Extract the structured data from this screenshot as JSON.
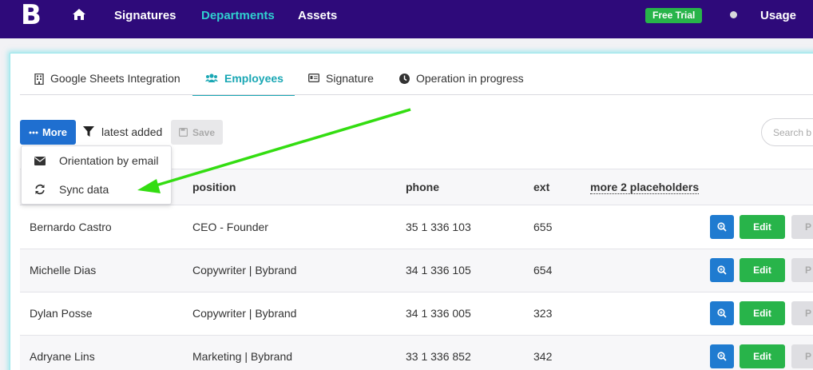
{
  "nav": {
    "logo": "B",
    "links": [
      "Signatures",
      "Departments",
      "Assets"
    ],
    "trial_badge": "Free Trial",
    "usage": "Usage"
  },
  "tabs": [
    "Google Sheets Integration",
    "Employees",
    "Signature",
    "Operation in progress"
  ],
  "toolbar": {
    "more_label": "More",
    "filter_label": "latest added",
    "save_label": "Save",
    "search_placeholder": "Search b"
  },
  "dropdown": {
    "items": [
      "Orientation by email",
      "Sync data"
    ]
  },
  "table": {
    "columns": [
      "position",
      "phone",
      "ext",
      "more 2 placeholders"
    ],
    "rows": [
      {
        "name": "Bernardo Castro",
        "position": "CEO - Founder",
        "phone": "35 1 336 103",
        "ext": "655"
      },
      {
        "name": "Michelle Dias",
        "position": "Copywriter | Bybrand",
        "phone": "34 1 336 105",
        "ext": "654"
      },
      {
        "name": "Dylan Posse",
        "position": "Copywriter | Bybrand",
        "phone": "34 1 336 005",
        "ext": "323"
      },
      {
        "name": "Adryane Lins",
        "position": "Marketing | Bybrand",
        "phone": "33 1 336 852",
        "ext": "342"
      }
    ],
    "edit_label": "Edit",
    "partial_button_label": "P"
  },
  "colors": {
    "nav_bg": "#2e0a7a",
    "active_link": "#2fd0d0",
    "primary_blue": "#1f6fd0",
    "success_green": "#28b44a",
    "annotation_arrow": "#33dd11"
  },
  "icons": [
    "home-icon",
    "building-icon",
    "users-icon",
    "id-card-icon",
    "clock-icon",
    "ellipsis-icon",
    "filter-icon",
    "save-icon",
    "envelope-icon",
    "sync-icon",
    "magnify-icon"
  ]
}
